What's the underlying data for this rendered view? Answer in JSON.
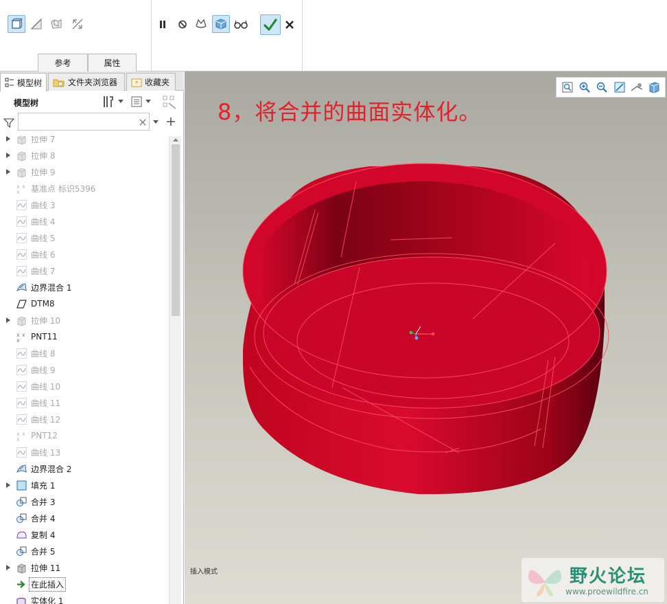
{
  "ribbon": {
    "tabs": [
      "参考",
      "属性"
    ]
  },
  "panel": {
    "tabs": [
      "模型树",
      "文件夹浏览器",
      "收藏夹"
    ],
    "tree_title": "模型树",
    "filter_value": "",
    "items": [
      {
        "label": "拉伸 7",
        "icon": "extrude-icon",
        "dim": true,
        "expandable": true
      },
      {
        "label": "拉伸 8",
        "icon": "extrude-icon",
        "dim": true,
        "expandable": true
      },
      {
        "label": "拉伸 9",
        "icon": "extrude-icon",
        "dim": true,
        "expandable": true
      },
      {
        "label": "基准点 标识5396",
        "icon": "datum-point-icon",
        "dim": true,
        "expandable": false
      },
      {
        "label": "曲线 3",
        "icon": "curve-icon",
        "dim": true,
        "expandable": false
      },
      {
        "label": "曲线 4",
        "icon": "curve-icon",
        "dim": true,
        "expandable": false
      },
      {
        "label": "曲线 5",
        "icon": "curve-icon",
        "dim": true,
        "expandable": false
      },
      {
        "label": "曲线 6",
        "icon": "curve-icon",
        "dim": true,
        "expandable": false
      },
      {
        "label": "曲线 7",
        "icon": "curve-icon",
        "dim": true,
        "expandable": false
      },
      {
        "label": "边界混合 1",
        "icon": "boundary-blend-icon",
        "dim": false,
        "expandable": false
      },
      {
        "label": "DTM8",
        "icon": "datum-plane-icon",
        "dim": false,
        "expandable": false
      },
      {
        "label": "拉伸 10",
        "icon": "extrude-icon",
        "dim": true,
        "expandable": true
      },
      {
        "label": "PNT11",
        "icon": "datum-point-icon",
        "dim": false,
        "expandable": false
      },
      {
        "label": "曲线 8",
        "icon": "curve-icon",
        "dim": true,
        "expandable": false
      },
      {
        "label": "曲线 9",
        "icon": "curve-icon",
        "dim": true,
        "expandable": false
      },
      {
        "label": "曲线 10",
        "icon": "curve-icon",
        "dim": true,
        "expandable": false
      },
      {
        "label": "曲线 11",
        "icon": "curve-icon",
        "dim": true,
        "expandable": false
      },
      {
        "label": "曲线 12",
        "icon": "curve-icon",
        "dim": true,
        "expandable": false
      },
      {
        "label": "PNT12",
        "icon": "datum-point-icon",
        "dim": true,
        "expandable": false
      },
      {
        "label": "曲线 13",
        "icon": "curve-icon",
        "dim": true,
        "expandable": false
      },
      {
        "label": "边界混合 2",
        "icon": "boundary-blend-icon",
        "dim": false,
        "expandable": false
      },
      {
        "label": "填充 1",
        "icon": "fill-icon",
        "dim": false,
        "expandable": true
      },
      {
        "label": "合并 3",
        "icon": "merge-icon",
        "dim": false,
        "expandable": false
      },
      {
        "label": "合并 4",
        "icon": "merge-icon",
        "dim": false,
        "expandable": false
      },
      {
        "label": "复制 4",
        "icon": "copy-icon",
        "dim": false,
        "expandable": false
      },
      {
        "label": "合并 5",
        "icon": "merge-icon",
        "dim": false,
        "expandable": false
      },
      {
        "label": "拉伸 11",
        "icon": "extrude-icon",
        "dim": false,
        "expandable": true
      },
      {
        "label": "在此插入",
        "icon": "insert-here-arrow-icon",
        "dim": false,
        "expandable": false,
        "insert": true
      },
      {
        "label": "实体化 1",
        "icon": "solidify-icon",
        "dim": false,
        "expandable": false
      }
    ]
  },
  "viewport": {
    "caption": "8，将合并的曲面实体化。",
    "mode_text": "插入模式"
  },
  "watermark": {
    "title": "野火论坛",
    "url": "www.proewildfire.cn"
  },
  "colors": {
    "model_red": "#d4062b",
    "caption_red": "#e0232a",
    "accent_blue": "#cfe6f7",
    "confirm_green": "#1f8a2c",
    "watermark_green": "#2a8f74"
  }
}
